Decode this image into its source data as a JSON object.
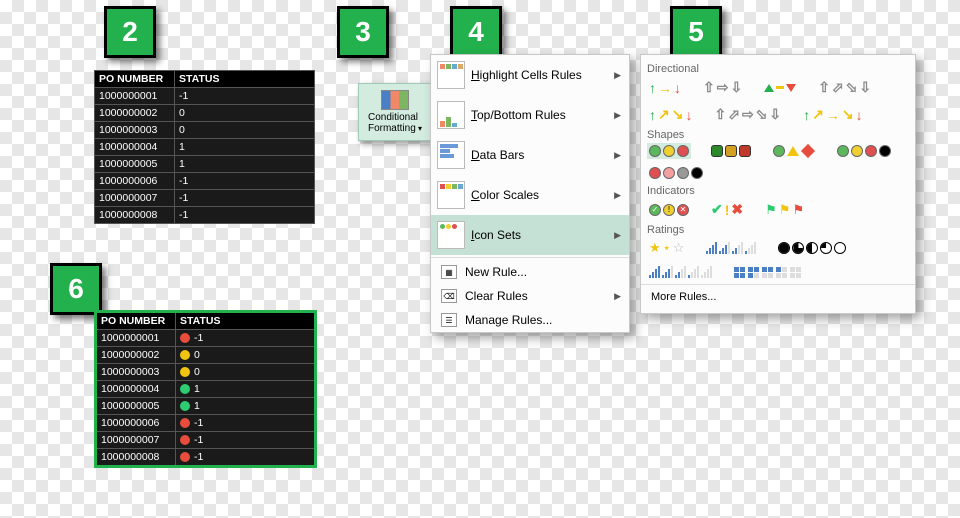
{
  "callouts": {
    "c2": "2",
    "c3": "3",
    "c4": "4",
    "c5": "5",
    "c6": "6"
  },
  "table": {
    "headers": [
      "PO NUMBER",
      "STATUS"
    ],
    "rows": [
      {
        "po": "1000000001",
        "status": "-1",
        "icon": "r"
      },
      {
        "po": "1000000002",
        "status": "0",
        "icon": "y"
      },
      {
        "po": "1000000003",
        "status": "0",
        "icon": "y"
      },
      {
        "po": "1000000004",
        "status": "1",
        "icon": "g"
      },
      {
        "po": "1000000005",
        "status": "1",
        "icon": "g"
      },
      {
        "po": "1000000006",
        "status": "-1",
        "icon": "r"
      },
      {
        "po": "1000000007",
        "status": "-1",
        "icon": "r"
      },
      {
        "po": "1000000008",
        "status": "-1",
        "icon": "r"
      }
    ]
  },
  "cf_button": {
    "label": "Conditional Formatting"
  },
  "menu": {
    "items": [
      {
        "key": "highlight",
        "label": "Highlight Cells Rules",
        "u": "H"
      },
      {
        "key": "topbottom",
        "label": "Top/Bottom Rules",
        "u": "T"
      },
      {
        "key": "databars",
        "label": "Data Bars",
        "u": "D"
      },
      {
        "key": "colorscales",
        "label": "Color Scales",
        "u": "C"
      },
      {
        "key": "iconsets",
        "label": "Icon Sets",
        "u": "I",
        "selected": true
      }
    ],
    "sub": [
      {
        "key": "newrule",
        "label": "New Rule...",
        "u": "N"
      },
      {
        "key": "clear",
        "label": "Clear Rules",
        "u": "C"
      },
      {
        "key": "manage",
        "label": "Manage Rules...",
        "u": "M"
      }
    ]
  },
  "gallery": {
    "groups": [
      "Directional",
      "Shapes",
      "Indicators",
      "Ratings"
    ],
    "more": "More Rules...",
    "more_u": "M"
  }
}
